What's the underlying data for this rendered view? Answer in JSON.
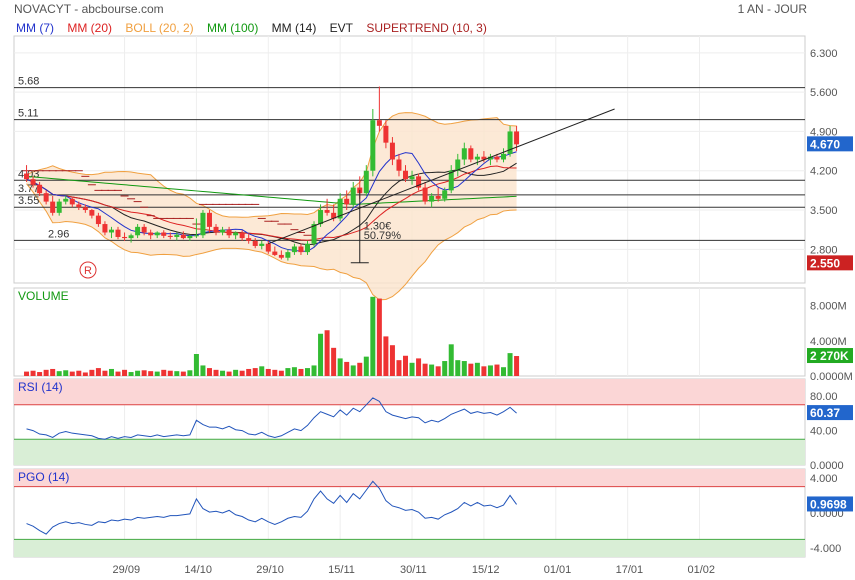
{
  "header": {
    "title": "NOVACYT - abcbourse.com",
    "period": "1 AN - JOUR"
  },
  "legend": [
    {
      "label": "MM (7)",
      "color": "#2233cc"
    },
    {
      "label": "MM (20)",
      "color": "#dd2222"
    },
    {
      "label": "BOLL (20, 2)",
      "color": "#f0a040"
    },
    {
      "label": "MM (100)",
      "color": "#119911"
    },
    {
      "label": "MM (14)",
      "color": "#222222"
    },
    {
      "label": "EVT",
      "color": "#222222"
    },
    {
      "label": "SUPERTREND (10, 3)",
      "color": "#aa2222"
    }
  ],
  "colors": {
    "up": "#33bb33",
    "down": "#ee3333",
    "last_badge": "#2266cc",
    "supertrend": "#aa2222"
  },
  "chart_data": {
    "type": "candlestick",
    "x_labels": [
      {
        "date": "29/09",
        "pos": 16
      },
      {
        "date": "14/10",
        "pos": 27
      },
      {
        "date": "29/10",
        "pos": 38
      },
      {
        "date": "15/11",
        "pos": 49
      },
      {
        "date": "30/11",
        "pos": 60
      },
      {
        "date": "15/12",
        "pos": 71
      },
      {
        "date": "01/01",
        "pos": 82
      },
      {
        "date": "17/01",
        "pos": 93
      },
      {
        "date": "01/02",
        "pos": 104
      }
    ],
    "price": {
      "ylim": [
        2.2,
        6.6
      ],
      "ticks": [
        "6.300",
        "5.600",
        "4.900",
        "4.200",
        "3.500",
        "2.800"
      ],
      "tick_values": [
        6.3,
        5.6,
        4.9,
        4.2,
        3.5,
        2.8
      ],
      "last_value": "4.670",
      "last_value_num": 4.67,
      "marker": "2.550",
      "marker_num": 2.55,
      "hlines": [
        {
          "value": 5.68,
          "label": "5.68"
        },
        {
          "value": 5.11,
          "label": "5.11"
        },
        {
          "value": 4.03,
          "label": "4.03"
        },
        {
          "value": 3.77,
          "label": "3.77"
        },
        {
          "value": 3.55,
          "label": "3.55"
        },
        {
          "value": 2.96,
          "label": "2.96"
        }
      ],
      "trendline": [
        [
          38,
          2.9
        ],
        [
          91,
          5.3
        ]
      ],
      "annotation": {
        "text1": "1.30€",
        "text2": "50.79%",
        "x": 52,
        "low": 2.56,
        "high": 3.86
      },
      "r_marker": "R",
      "candles": [
        [
          4.15,
          4.3,
          4.0,
          4.05
        ],
        [
          4.05,
          4.1,
          3.9,
          3.95
        ],
        [
          3.95,
          4.0,
          3.75,
          3.8
        ],
        [
          3.8,
          3.85,
          3.6,
          3.65
        ],
        [
          3.65,
          3.75,
          3.4,
          3.45
        ],
        [
          3.45,
          3.7,
          3.4,
          3.65
        ],
        [
          3.65,
          3.75,
          3.6,
          3.7
        ],
        [
          3.7,
          3.72,
          3.55,
          3.6
        ],
        [
          3.6,
          3.65,
          3.5,
          3.55
        ],
        [
          3.55,
          3.6,
          3.45,
          3.5
        ],
        [
          3.5,
          3.52,
          3.35,
          3.4
        ],
        [
          3.4,
          3.45,
          3.2,
          3.25
        ],
        [
          3.25,
          3.3,
          3.05,
          3.1
        ],
        [
          3.1,
          3.2,
          3.0,
          3.15
        ],
        [
          3.15,
          3.2,
          2.98,
          3.02
        ],
        [
          3.02,
          3.1,
          2.95,
          3.0
        ],
        [
          3.0,
          3.08,
          2.92,
          3.05
        ],
        [
          3.05,
          3.25,
          3.0,
          3.2
        ],
        [
          3.2,
          3.25,
          3.05,
          3.1
        ],
        [
          3.1,
          3.15,
          2.98,
          3.05
        ],
        [
          3.05,
          3.12,
          3.0,
          3.1
        ],
        [
          3.1,
          3.14,
          3.0,
          3.04
        ],
        [
          3.04,
          3.1,
          2.98,
          3.02
        ],
        [
          3.02,
          3.1,
          2.96,
          3.06
        ],
        [
          3.06,
          3.12,
          2.98,
          3.0
        ],
        [
          3.0,
          3.06,
          2.95,
          3.04
        ],
        [
          3.04,
          3.35,
          3.0,
          3.05
        ],
        [
          3.05,
          3.5,
          3.0,
          3.45
        ],
        [
          3.45,
          3.5,
          3.1,
          3.2
        ],
        [
          3.2,
          3.25,
          3.05,
          3.1
        ],
        [
          3.1,
          3.2,
          3.05,
          3.15
        ],
        [
          3.15,
          3.2,
          3.0,
          3.05
        ],
        [
          3.05,
          3.12,
          2.98,
          3.1
        ],
        [
          3.1,
          3.14,
          2.95,
          3.0
        ],
        [
          3.0,
          3.08,
          2.9,
          2.95
        ],
        [
          2.95,
          3.0,
          2.82,
          2.86
        ],
        [
          2.86,
          2.95,
          2.8,
          2.9
        ],
        [
          2.9,
          2.95,
          2.72,
          2.76
        ],
        [
          2.76,
          2.85,
          2.68,
          2.7
        ],
        [
          2.7,
          2.78,
          2.62,
          2.65
        ],
        [
          2.65,
          2.8,
          2.6,
          2.75
        ],
        [
          2.75,
          2.9,
          2.7,
          2.85
        ],
        [
          2.85,
          2.9,
          2.7,
          2.75
        ],
        [
          2.75,
          2.95,
          2.7,
          2.9
        ],
        [
          2.9,
          3.3,
          2.85,
          3.25
        ],
        [
          3.25,
          3.6,
          3.2,
          3.5
        ],
        [
          3.5,
          3.7,
          3.4,
          3.45
        ],
        [
          3.45,
          3.6,
          3.3,
          3.35
        ],
        [
          3.35,
          3.8,
          3.3,
          3.7
        ],
        [
          3.7,
          3.85,
          3.5,
          3.6
        ],
        [
          3.6,
          4.0,
          3.55,
          3.9
        ],
        [
          3.9,
          4.1,
          3.7,
          3.8
        ],
        [
          3.8,
          4.3,
          3.75,
          4.2
        ],
        [
          4.2,
          5.3,
          4.1,
          5.1
        ],
        [
          5.1,
          5.7,
          4.9,
          5.0
        ],
        [
          5.0,
          5.1,
          4.6,
          4.7
        ],
        [
          4.7,
          4.8,
          4.3,
          4.4
        ],
        [
          4.4,
          4.5,
          4.1,
          4.2
        ],
        [
          4.2,
          4.3,
          4.0,
          4.05
        ],
        [
          4.05,
          4.2,
          3.95,
          4.1
        ],
        [
          4.1,
          4.15,
          3.85,
          3.9
        ],
        [
          3.9,
          4.0,
          3.6,
          3.65
        ],
        [
          3.65,
          3.8,
          3.55,
          3.75
        ],
        [
          3.75,
          3.9,
          3.65,
          3.7
        ],
        [
          3.7,
          3.9,
          3.65,
          3.85
        ],
        [
          3.85,
          4.3,
          3.8,
          4.2
        ],
        [
          4.2,
          4.5,
          4.1,
          4.4
        ],
        [
          4.4,
          4.7,
          4.3,
          4.6
        ],
        [
          4.6,
          4.65,
          4.35,
          4.4
        ],
        [
          4.4,
          4.5,
          4.3,
          4.45
        ],
        [
          4.45,
          4.55,
          4.35,
          4.4
        ],
        [
          4.4,
          4.5,
          4.3,
          4.45
        ],
        [
          4.45,
          4.5,
          4.35,
          4.4
        ],
        [
          4.4,
          4.6,
          4.35,
          4.5
        ],
        [
          4.5,
          5.0,
          4.45,
          4.9
        ],
        [
          4.9,
          5.0,
          4.55,
          4.67
        ]
      ]
    },
    "volume": {
      "title": "VOLUME",
      "ylim": [
        0,
        10000
      ],
      "ticks": [
        "8.000M",
        "4.000M",
        "0.0000M"
      ],
      "tick_values": [
        8000,
        4000,
        0
      ],
      "last_value": "2 270K",
      "last_value_num": 2270,
      "values": [
        500,
        600,
        450,
        700,
        800,
        550,
        650,
        500,
        600,
        400,
        700,
        900,
        600,
        800,
        500,
        700,
        450,
        600,
        650,
        550,
        500,
        700,
        600,
        550,
        500,
        650,
        2500,
        1200,
        900,
        700,
        600,
        500,
        700,
        600,
        800,
        900,
        1100,
        800,
        700,
        600,
        900,
        1000,
        800,
        900,
        1200,
        4800,
        5200,
        3200,
        2000,
        1600,
        1200,
        1500,
        2200,
        9000,
        8800,
        4500,
        3500,
        1800,
        2300,
        1500,
        2000,
        1400,
        1300,
        1100,
        1700,
        3600,
        1800,
        1700,
        1400,
        1500,
        1100,
        1200,
        1300,
        1000,
        2600,
        2270
      ]
    },
    "rsi": {
      "title": "RSI (14)",
      "ylim": [
        0,
        100
      ],
      "ticks": [
        "80.00",
        "40.00",
        "0.0000"
      ],
      "tick_values": [
        80,
        40,
        0
      ],
      "overbought": 70,
      "oversold": 30,
      "last_value": "60.37",
      "last_value_num": 60.37,
      "values": [
        42,
        40,
        36,
        35,
        32,
        37,
        39,
        37,
        36,
        35,
        34,
        31,
        30,
        33,
        31,
        33,
        32,
        35,
        34,
        33,
        35,
        33,
        34,
        35,
        34,
        35,
        52,
        47,
        44,
        44,
        42,
        45,
        41,
        40,
        36,
        35,
        38,
        34,
        32,
        34,
        38,
        42,
        40,
        46,
        55,
        62,
        59,
        56,
        64,
        58,
        66,
        62,
        70,
        78,
        74,
        62,
        58,
        56,
        54,
        56,
        55,
        49,
        52,
        50,
        54,
        59,
        62,
        65,
        60,
        62,
        60,
        61,
        58,
        62,
        67,
        60.37
      ]
    },
    "pgo": {
      "title": "PGO (14)",
      "ylim": [
        -5,
        5
      ],
      "ticks": [
        "4.000",
        "0.0000",
        "-4.000"
      ],
      "tick_values": [
        4,
        0,
        -4
      ],
      "overbought": 3,
      "oversold": -3,
      "last_value": "0.9698",
      "last_value_num": 0.9698,
      "values": [
        -1.2,
        -1.5,
        -2.0,
        -2.4,
        -1.6,
        -1.2,
        -1.0,
        -1.2,
        -1.1,
        -1.3,
        -1.4,
        -1.0,
        -1.1,
        -0.8,
        -0.9,
        -0.7,
        -0.8,
        -0.5,
        -0.6,
        -0.5,
        -0.4,
        -0.5,
        -0.3,
        -0.3,
        -0.2,
        -0.1,
        1.6,
        0.5,
        0.1,
        0.2,
        0.0,
        0.3,
        -0.2,
        -0.4,
        -0.8,
        -1.0,
        -0.6,
        -1.0,
        -1.3,
        -1.0,
        -0.6,
        -0.4,
        -0.5,
        0.2,
        1.6,
        2.5,
        1.6,
        1.1,
        2.0,
        1.2,
        2.2,
        1.6,
        2.6,
        3.6,
        2.8,
        1.4,
        0.8,
        0.6,
        0.3,
        0.4,
        0.1,
        -0.6,
        -0.5,
        -0.7,
        -0.2,
        0.1,
        0.5,
        1.2,
        0.8,
        1.2,
        0.8,
        0.9,
        0.6,
        0.9,
        2.0,
        0.9698
      ]
    }
  }
}
